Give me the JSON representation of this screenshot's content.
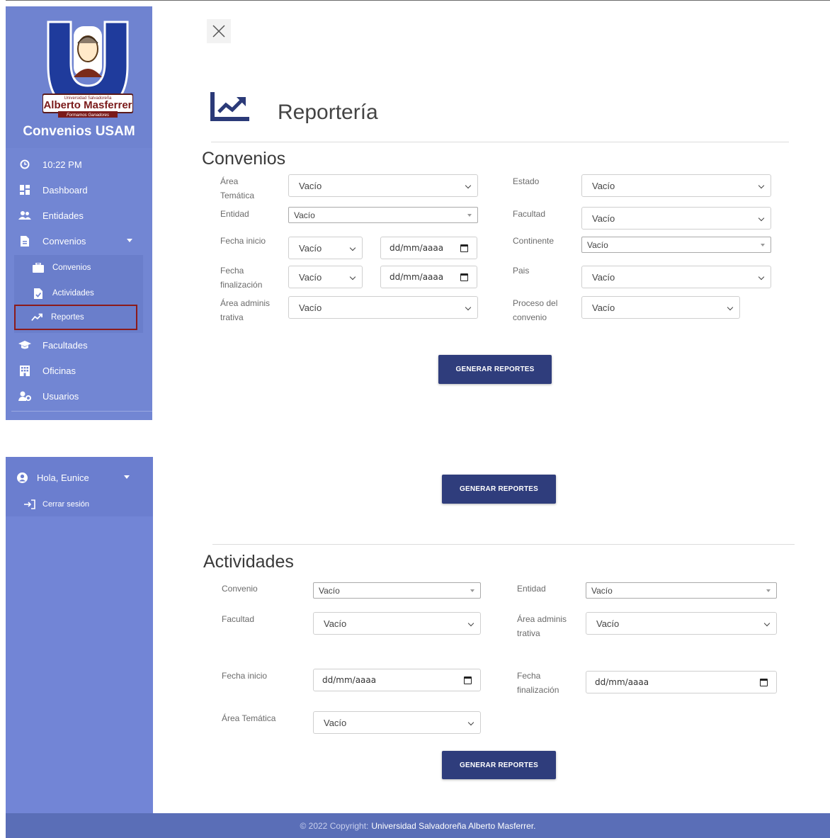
{
  "sidebar": {
    "logo_alt": "Universidad Salvadoreña Alberto Masferrer - Formamos Ganadores",
    "logo_text_small": "Universidad Salvadoreña",
    "logo_text_big": "Alberto Masferrer",
    "logo_text_slogan": "Formamos Ganadores",
    "title": "Convenios USAM",
    "items": [
      {
        "label": "10:22 PM",
        "icon": "clock-icon"
      },
      {
        "label": "Dashboard",
        "icon": "dashboard-icon"
      },
      {
        "label": "Entidades",
        "icon": "users-icon"
      },
      {
        "label": "Convenios",
        "icon": "file-icon"
      },
      {
        "label": "Facultades",
        "icon": "graduation-cap-icon"
      },
      {
        "label": "Oficinas",
        "icon": "building-icon"
      },
      {
        "label": "Usuarios",
        "icon": "user-gear-icon"
      }
    ],
    "sub_items": [
      {
        "label": "Convenios",
        "icon": "briefcase-icon"
      },
      {
        "label": "Actividades",
        "icon": "file-check-icon"
      },
      {
        "label": "Reportes",
        "icon": "chart-line-icon"
      }
    ],
    "user": {
      "greeting": "Hola, Eunice",
      "logout": "Cerrar sesión"
    }
  },
  "page": {
    "title": "Reportería",
    "close_icon": "close-icon"
  },
  "convenios": {
    "title": "Convenios",
    "labels": {
      "area_tematica": "Área Temática",
      "estado": "Estado",
      "entidad": "Entidad",
      "facultad": "Facultad",
      "fecha_inicio": "Fecha inicio",
      "continente": "Continente",
      "fecha_finalizacion": "Fecha finalización",
      "pais": "Pais",
      "area_administrativa": "Área administrativa",
      "proceso": "Proceso del convenio"
    },
    "values": {
      "area_tematica": "Vacío",
      "estado": "Vacío",
      "entidad": "Vacío",
      "facultad": "Vacío",
      "fecha_inicio_sel": "Vacío",
      "fecha_inicio_date": "dd/mm/aaaa",
      "continente": "Vacío",
      "fecha_fin_sel": "Vacío",
      "fecha_fin_date": "dd/mm/aaaa",
      "pais": "Vacío",
      "area_administrativa": "Vacío",
      "proceso": "Vacío"
    },
    "button": "GENERAR REPORTES"
  },
  "middle_button": "GENERAR REPORTES",
  "actividades": {
    "title": "Actividades",
    "labels": {
      "convenio": "Convenio",
      "entidad": "Entidad",
      "facultad": "Facultad",
      "area_administrativa": "Área administrativa",
      "fecha_inicio": "Fecha inicio",
      "fecha_finalizacion": "Fecha finalización",
      "area_tematica": "Área Temática"
    },
    "values": {
      "convenio": "Vacío",
      "entidad": "Vacío",
      "facultad": "Vacío",
      "area_administrativa": "Vacío",
      "fecha_inicio": "dd/mm/aaaa",
      "fecha_finalizacion": "dd/mm/aaaa",
      "area_tematica": "Vacío"
    },
    "button": "GENERAR REPORTES"
  },
  "footer": {
    "copyright": "© 2022 Copyright:",
    "brand": "Universidad Salvadoreña Alberto Masferrer."
  }
}
